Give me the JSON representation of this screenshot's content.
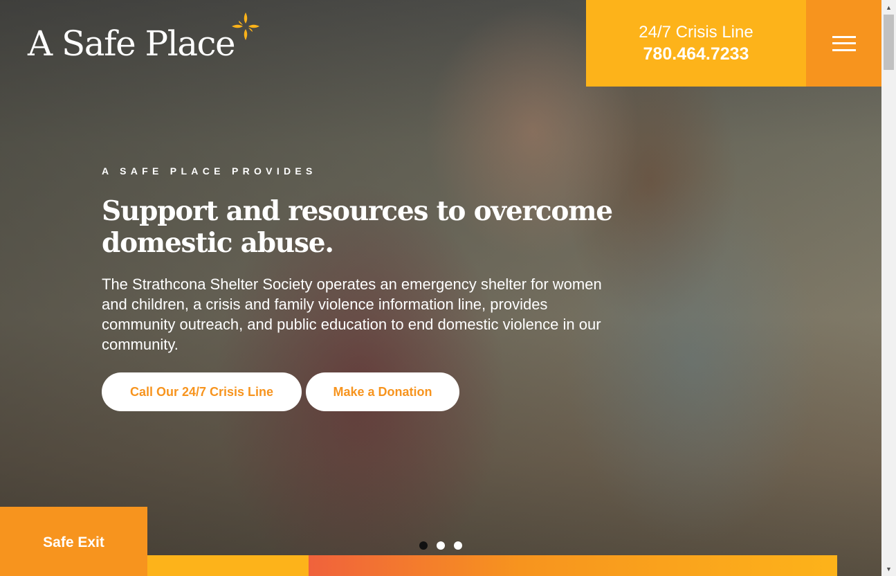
{
  "header": {
    "logo_text": "A Safe Place",
    "crisis_line_label": "24/7 Crisis Line",
    "crisis_line_phone": "780.464.7233",
    "menu_icon": "hamburger-icon"
  },
  "hero": {
    "eyebrow": "A SAFE PLACE PROVIDES",
    "headline": "Support and resources to overcome domestic abuse.",
    "description": "The Strathcona Shelter Society operates an emergency shelter for women and children, a crisis and family violence information line, provides community outreach, and public education to end domestic violence in our community.",
    "buttons": {
      "crisis": "Call Our 24/7 Crisis Line",
      "donate": "Make a Donation"
    },
    "slides": {
      "count": 3,
      "active": 1
    }
  },
  "safe_exit": {
    "label": "Safe Exit"
  },
  "colors": {
    "brand_yellow": "#fdb31a",
    "brand_orange": "#f7941e",
    "brand_red_orange": "#f0623c",
    "button_text": "#f7941e"
  },
  "scrollbar": {
    "up_icon": "arrow-up-icon",
    "down_icon": "arrow-down-icon"
  }
}
